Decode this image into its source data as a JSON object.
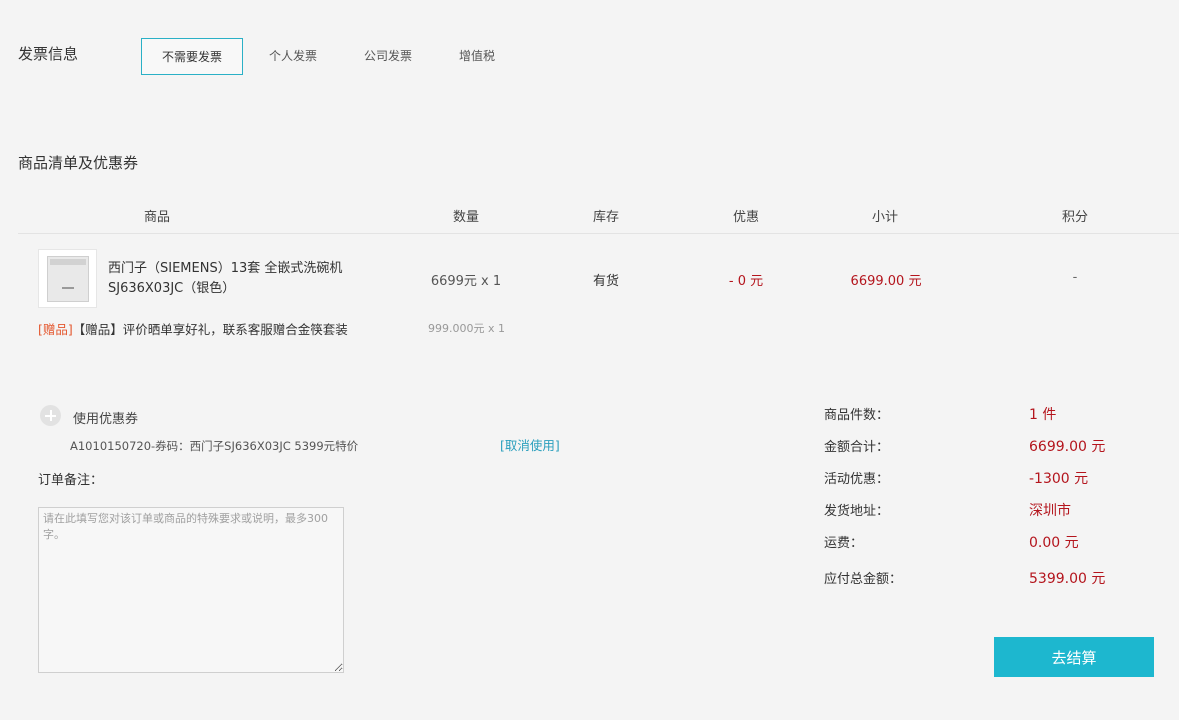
{
  "invoice": {
    "title": "发票信息",
    "tabs": [
      {
        "label": "不需要发票",
        "active": true
      },
      {
        "label": "个人发票",
        "active": false
      },
      {
        "label": "公司发票",
        "active": false
      },
      {
        "label": "增值税",
        "active": false
      }
    ]
  },
  "goods": {
    "title": "商品清单及优惠券",
    "headers": [
      "商品",
      "数量",
      "库存",
      "优惠",
      "小计",
      "积分"
    ],
    "item": {
      "name_line1": "西门子（SIEMENS）13套 全嵌式洗碗机",
      "name_line2": "SJ636X03JC（银色）",
      "quantity": "6699元 x 1",
      "stock": "有货",
      "discount": "- 0 元",
      "subtotal": "6699.00 元",
      "points": "-",
      "image_icon": "dishwasher-image"
    },
    "gift": {
      "tag": "[赠品]",
      "text": "【赠品】评价晒单享好礼，联系客服赠合金筷套装",
      "quantity": "999.000元 x 1"
    }
  },
  "coupon": {
    "label": "使用优惠券",
    "code_text": "A1010150720-券码：西门子SJ636X03JC 5399元特价",
    "cancel_label": "[取消使用]"
  },
  "remark": {
    "label": "订单备注：",
    "placeholder": "请在此填写您对该订单或商品的特殊要求或说明，最多300字。"
  },
  "summary": {
    "rows": [
      {
        "label": "商品件数：",
        "value": "1 件"
      },
      {
        "label": "金额合计：",
        "value": "6699.00 元"
      },
      {
        "label": "活动优惠：",
        "value": "-1300 元"
      },
      {
        "label": "发货地址：",
        "value": "深圳市"
      },
      {
        "label": "运费：",
        "value": "0.00 元"
      },
      {
        "label": "应付总金额：",
        "value": "5399.00 元"
      }
    ]
  },
  "checkout_label": "去结算",
  "colors": {
    "accent": "#1db7cf",
    "price_red": "#b4151d",
    "tab_border": "#2ab0c6",
    "gift_tag": "#e4572e",
    "link": "#2a9fbd"
  }
}
